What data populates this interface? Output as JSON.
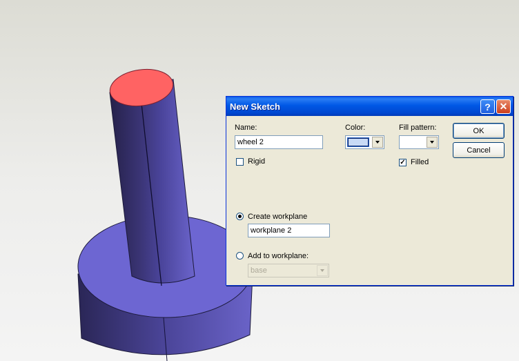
{
  "dialog": {
    "title": "New Sketch",
    "help_glyph": "?",
    "close_glyph": "✕",
    "name_label": "Name:",
    "name_value": "wheel 2",
    "color_label": "Color:",
    "color_value": "#c8daf6",
    "fill_pattern_label": "Fill pattern:",
    "fill_pattern_value": "",
    "ok_label": "OK",
    "cancel_label": "Cancel",
    "rigid_label": "Rigid",
    "rigid_checked": false,
    "filled_label": "Filled",
    "filled_checked": true,
    "create_workplane_label": "Create workplane",
    "create_workplane_value": "workplane 2",
    "create_workplane_selected": true,
    "add_workplane_label": "Add to workplane:",
    "add_workplane_value": "base",
    "add_workplane_selected": false
  },
  "viewport": {
    "model": "cylinder-on-base",
    "body_color": "#6b63c9",
    "top_face_color": "#ff6363",
    "background_color": "#f0f0ee"
  }
}
